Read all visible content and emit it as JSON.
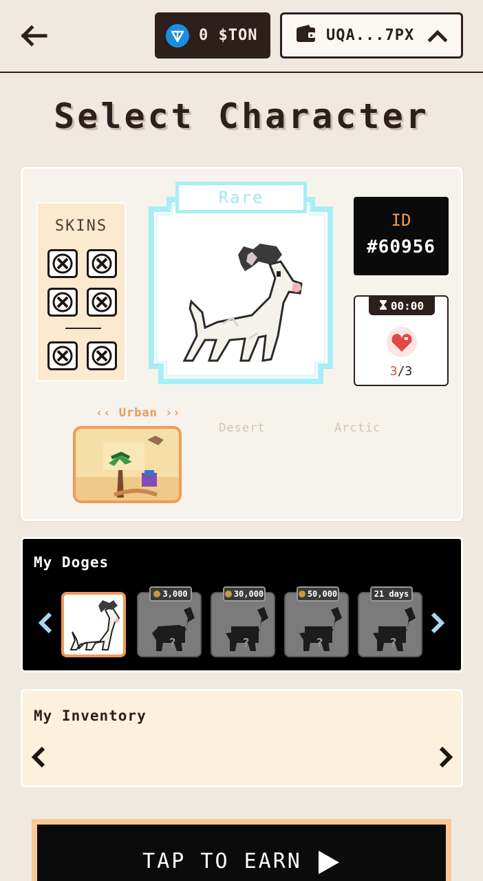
{
  "header": {
    "ton_balance": "0 $TON",
    "wallet_address": "UQA...7PX"
  },
  "page_title": "Select Character",
  "character": {
    "rarity": "Rare",
    "id_label": "ID",
    "id_value": "#60956",
    "timer": "00:00",
    "energy_current": "3",
    "energy_max": "/3"
  },
  "skins": {
    "title": "SKINS"
  },
  "environments": [
    {
      "label": "‹‹ Urban ››",
      "active": true
    },
    {
      "label": "Desert",
      "active": false
    },
    {
      "label": "Arctic",
      "active": false
    }
  ],
  "doges": {
    "title": "My Doges",
    "cards": [
      {
        "tag": ""
      },
      {
        "tag": "3,000"
      },
      {
        "tag": "30,000"
      },
      {
        "tag": "50,000"
      },
      {
        "tag": "21 days"
      }
    ]
  },
  "inventory": {
    "title": "My Inventory"
  },
  "cta": {
    "label": "TAP TO EARN"
  },
  "colors": {
    "accent_orange": "#f09a5a",
    "rare_cyan": "#a7eef6",
    "background": "#f0e9df",
    "dark": "#2b201c"
  }
}
